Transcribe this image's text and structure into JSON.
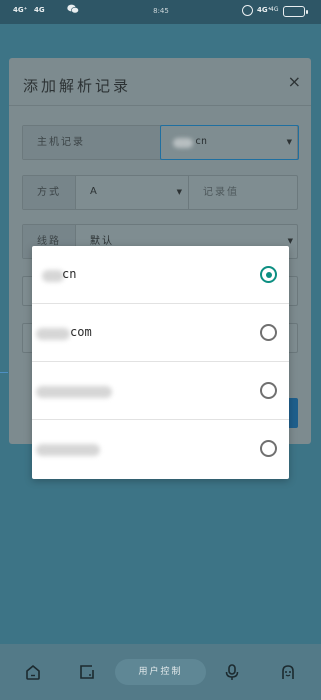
{
  "status_bar": {
    "signal_1": "4G⁺",
    "signal_2": "4G",
    "time": "8:45",
    "signal_3": "4G⁺",
    "battery_label": "4G"
  },
  "form": {
    "title": "添加解析记录",
    "close_glyph": "×",
    "host_label": "主机记录",
    "host_value_suffix": "cn",
    "type_label": "方式",
    "type_value": "A",
    "record_value_placeholder": "记录值",
    "line_label": "线路",
    "line_value": "默认"
  },
  "dropdown": {
    "options": [
      {
        "text": "cn",
        "selected": true
      },
      {
        "text": "com",
        "selected": false
      },
      {
        "text": "",
        "selected": false
      },
      {
        "text": "",
        "selected": false
      }
    ]
  },
  "bottom_bar": {
    "center_label": "用户控制"
  },
  "colors": {
    "accent": "#0d8f82",
    "page_bg": "#3d7486",
    "popup_bg": "#ffffff"
  }
}
